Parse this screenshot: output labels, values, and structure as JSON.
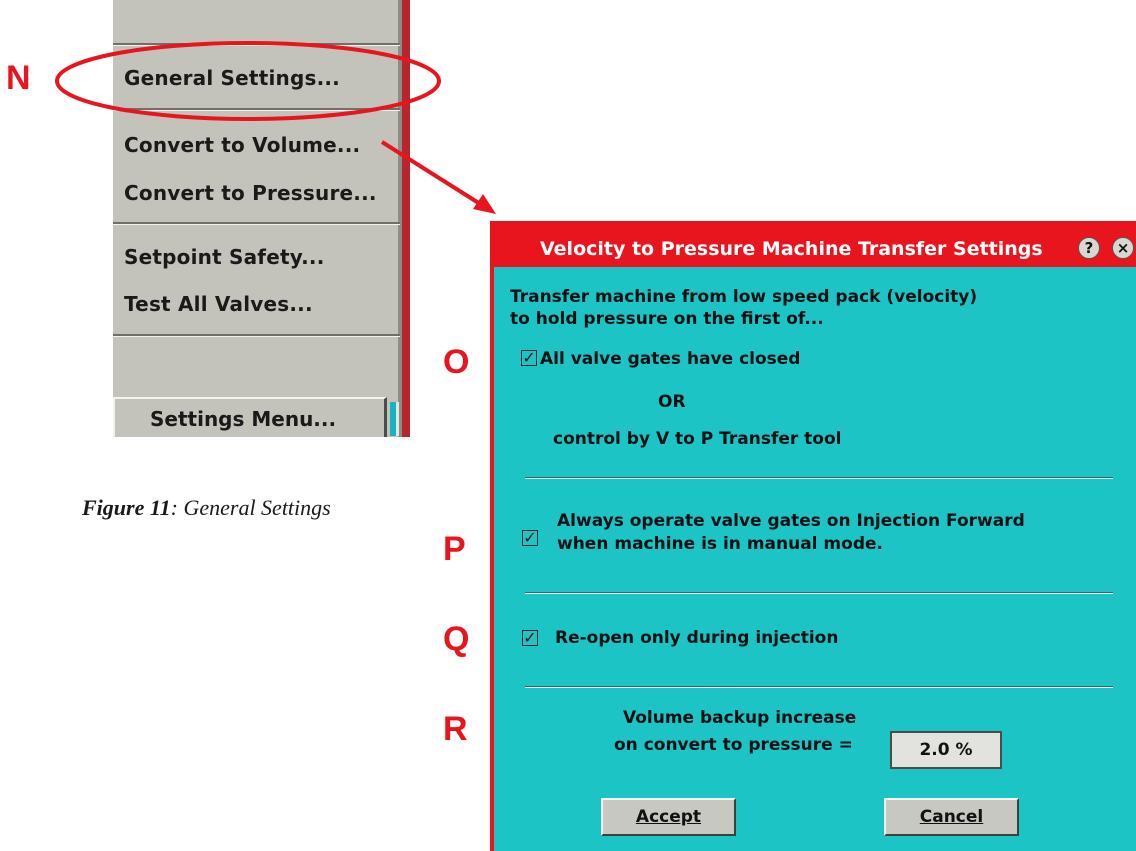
{
  "menu": {
    "items": [
      {
        "label": "General Settings..."
      },
      {
        "label": "Convert to Volume..."
      },
      {
        "label": "Convert to Pressure..."
      },
      {
        "label": "Setpoint Safety..."
      },
      {
        "label": "Test All Valves..."
      }
    ],
    "footer_label": "Settings Menu..."
  },
  "caption": {
    "figure": "Figure 11",
    "text": ": General Settings"
  },
  "annotations": {
    "n": "N",
    "o": "O",
    "p": "P",
    "q": "Q",
    "r": "R"
  },
  "dialog": {
    "title": "Velocity to Pressure Machine Transfer Settings",
    "help_icon": "?",
    "close_icon": "×",
    "intro_line1": "Transfer machine from low speed pack (velocity)",
    "intro_line2": "to hold pressure on the first of...",
    "check_all_gates": {
      "label": "All valve gates have closed",
      "checked": true
    },
    "or_label": "OR",
    "control_label": "control by V to P Transfer tool",
    "check_always_operate": {
      "line1": "Always operate valve gates on Injection Forward",
      "line2": "when machine is in manual mode.",
      "checked": true
    },
    "check_reopen": {
      "label": "Re-open only during injection",
      "checked": true
    },
    "backup_label_line1": "Volume backup increase",
    "backup_label_line2": "on convert to pressure =",
    "backup_value": "2.0 %",
    "accept_label": "Accept",
    "cancel_label": "Cancel"
  },
  "colors": {
    "annotation_red": "#e8141e",
    "dialog_body": "#1cc4c6",
    "menu_gray": "#c3c3bb"
  }
}
